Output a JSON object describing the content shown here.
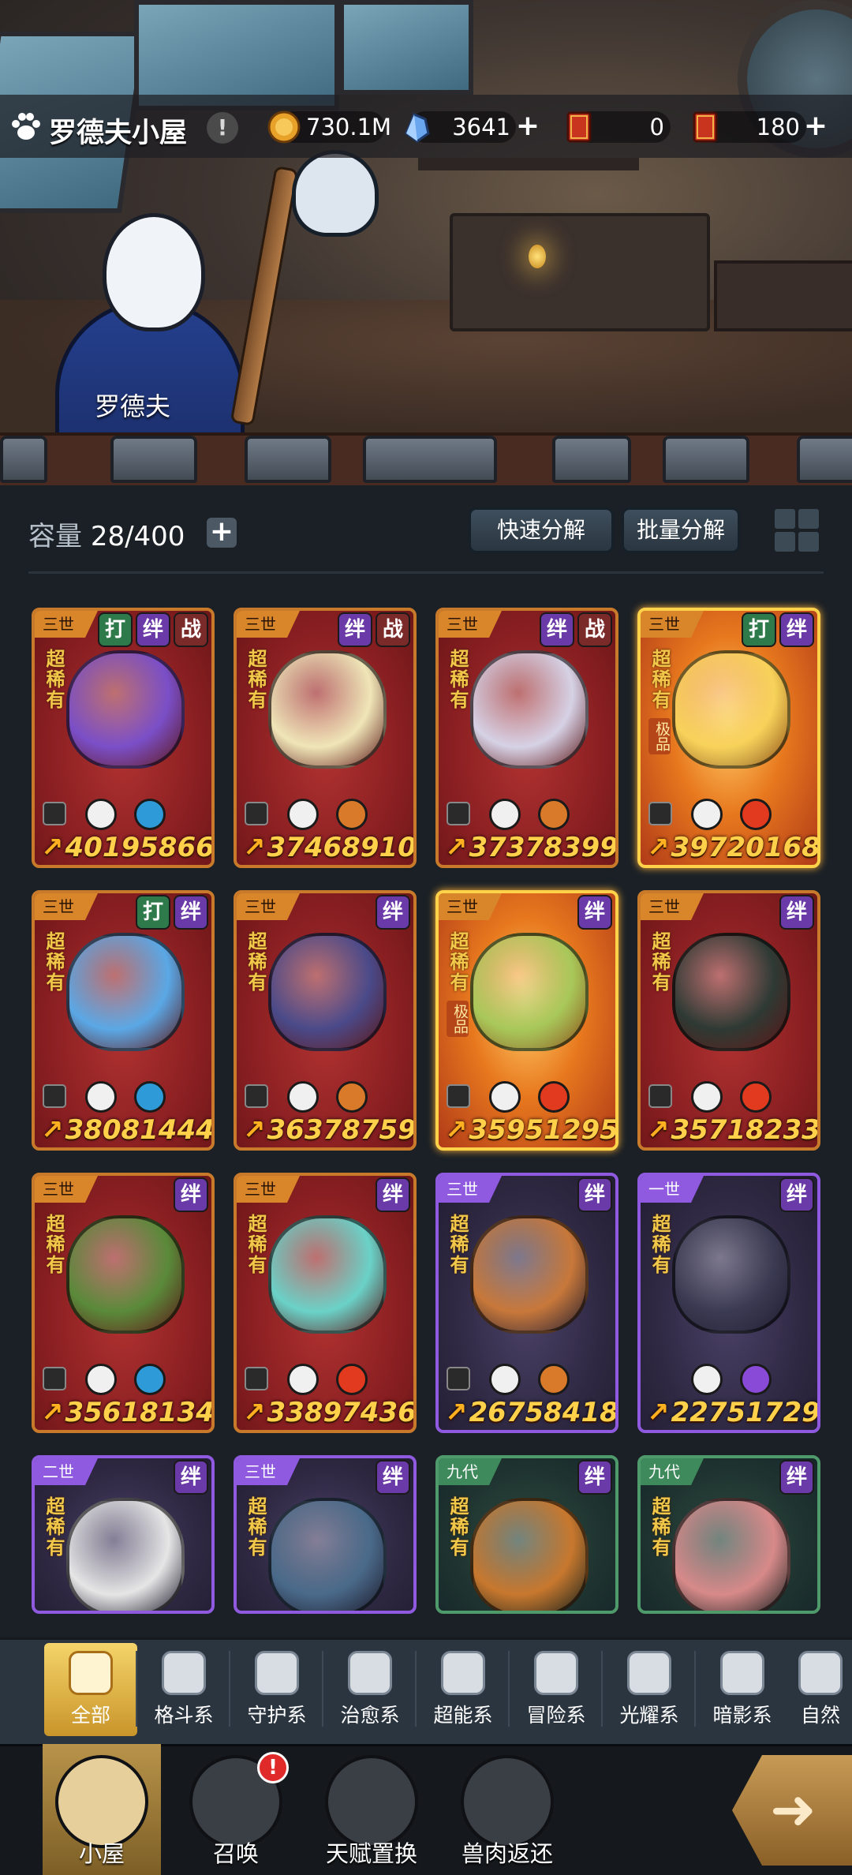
{
  "header": {
    "title": "罗德夫小屋",
    "npc_name": "罗德夫",
    "resources": [
      {
        "icon": "gold-coin-icon",
        "value": "730.1M",
        "has_plus": false
      },
      {
        "icon": "blue-crystal-icon",
        "value": "3641",
        "has_plus": true
      },
      {
        "icon": "red-ticket-icon",
        "value": "0",
        "has_plus": false,
        "ticket_char": "代"
      },
      {
        "icon": "red-ticket-icon",
        "value": "180",
        "has_plus": true,
        "ticket_char": "吉"
      }
    ]
  },
  "toolbar": {
    "capacity_label": "容量",
    "capacity_value": "28/400",
    "quick_decompose": "快速分解",
    "batch_decompose": "批量分解"
  },
  "cards": [
    {
      "gen": "三世",
      "tags": [
        "打",
        "绊",
        "战"
      ],
      "rarity": "超稀有",
      "excellent": "",
      "style": "red",
      "locked": true,
      "attrs": [
        "crystal",
        "water"
      ],
      "power": "40195866",
      "beast_color": "#7a4fc8"
    },
    {
      "gen": "三世",
      "tags": [
        "绊",
        "战"
      ],
      "rarity": "超稀有",
      "excellent": "",
      "style": "red",
      "locked": true,
      "attrs": [
        "fist",
        "earth"
      ],
      "power": "37468910",
      "beast_color": "#efe6b8"
    },
    {
      "gen": "三世",
      "tags": [
        "绊",
        "战"
      ],
      "rarity": "超稀有",
      "excellent": "",
      "style": "red",
      "locked": true,
      "attrs": [
        "psychic",
        "earth"
      ],
      "power": "37378399",
      "beast_color": "#d6d2e6"
    },
    {
      "gen": "三世",
      "tags": [
        "打",
        "绊"
      ],
      "rarity": "超稀有",
      "excellent": "极品",
      "style": "gold",
      "locked": true,
      "attrs": [
        "fist",
        "fire"
      ],
      "power": "39720168",
      "beast_color": "#f7d25a"
    },
    {
      "gen": "三世",
      "tags": [
        "打",
        "绊"
      ],
      "rarity": "超稀有",
      "excellent": "",
      "style": "red",
      "locked": true,
      "attrs": [
        "fist",
        "water"
      ],
      "power": "38081444",
      "beast_color": "#5aa8e6"
    },
    {
      "gen": "三世",
      "tags": [
        "绊"
      ],
      "rarity": "超稀有",
      "excellent": "",
      "style": "red",
      "locked": true,
      "attrs": [
        "shield",
        "earth"
      ],
      "power": "36378759",
      "beast_color": "#4a4a8a"
    },
    {
      "gen": "三世",
      "tags": [
        "绊"
      ],
      "rarity": "超稀有",
      "excellent": "极品",
      "style": "gold",
      "locked": true,
      "attrs": [
        "psychic",
        "fire"
      ],
      "power": "35951295",
      "beast_color": "#a8c85a"
    },
    {
      "gen": "三世",
      "tags": [
        "绊"
      ],
      "rarity": "超稀有",
      "excellent": "",
      "style": "red",
      "locked": true,
      "attrs": [
        "shield",
        "fire"
      ],
      "power": "35718233",
      "beast_color": "#2e3a34"
    },
    {
      "gen": "三世",
      "tags": [
        "绊"
      ],
      "rarity": "超稀有",
      "excellent": "",
      "style": "red",
      "locked": true,
      "attrs": [
        "shield",
        "water"
      ],
      "power": "35618134",
      "beast_color": "#5a8a3a"
    },
    {
      "gen": "三世",
      "tags": [
        "绊"
      ],
      "rarity": "超稀有",
      "excellent": "",
      "style": "red",
      "locked": true,
      "attrs": [
        "leaf",
        "fire"
      ],
      "power": "33897436",
      "beast_color": "#6ad2c8"
    },
    {
      "gen": "三世",
      "tags": [
        "绊"
      ],
      "rarity": "超稀有",
      "excellent": "",
      "style": "purple",
      "locked": true,
      "attrs": [
        "psychic",
        "earth"
      ],
      "power": "26758418",
      "beast_color": "#c8783a"
    },
    {
      "gen": "一世",
      "tags": [
        "绊"
      ],
      "rarity": "超稀有",
      "excellent": "",
      "style": "purple",
      "locked": false,
      "attrs": [
        "shadow",
        "moon"
      ],
      "power": "22751729",
      "beast_color": "#3a3a52"
    },
    {
      "gen": "二世",
      "tags": [
        "绊"
      ],
      "rarity": "超稀有",
      "excellent": "",
      "style": "purple",
      "locked": false,
      "attrs": [],
      "power": "",
      "beast_color": "#e6e6e6"
    },
    {
      "gen": "三世",
      "tags": [
        "绊"
      ],
      "rarity": "超稀有",
      "excellent": "",
      "style": "purple",
      "locked": false,
      "attrs": [],
      "power": "",
      "beast_color": "#4a6a8a"
    },
    {
      "gen": "九代",
      "tags": [
        "绊"
      ],
      "rarity": "超稀有",
      "excellent": "",
      "style": "green",
      "locked": false,
      "attrs": [],
      "power": "",
      "beast_color": "#c8782e"
    },
    {
      "gen": "九代",
      "tags": [
        "绊"
      ],
      "rarity": "超稀有",
      "excellent": "",
      "style": "green",
      "locked": false,
      "attrs": [],
      "power": "",
      "beast_color": "#d88a8a"
    }
  ],
  "categories": [
    {
      "label": "全部",
      "icon": "all-blocks-icon",
      "active": true
    },
    {
      "label": "格斗系",
      "icon": "fist-icon",
      "active": false
    },
    {
      "label": "守护系",
      "icon": "shield-icon",
      "active": false
    },
    {
      "label": "治愈系",
      "icon": "sprout-icon",
      "active": false
    },
    {
      "label": "超能系",
      "icon": "alien-icon",
      "active": false
    },
    {
      "label": "冒险系",
      "icon": "lantern-icon",
      "active": false
    },
    {
      "label": "光耀系",
      "icon": "star-icon",
      "active": false
    },
    {
      "label": "暗影系",
      "icon": "eye-icon",
      "active": false
    },
    {
      "label": "自然",
      "icon": "leaf-icon",
      "active": false
    }
  ],
  "nav": [
    {
      "label": "小屋",
      "icon": "house-icon",
      "active": true
    },
    {
      "label": "召唤",
      "icon": "egg-icon",
      "active": false,
      "badge": "!"
    },
    {
      "label": "天赋置换",
      "icon": "swap-arrows-icon",
      "active": false
    },
    {
      "label": "兽肉返还",
      "icon": "meat-icon",
      "active": false
    }
  ],
  "colors": {
    "accent_gold": "#f2c84a",
    "power_text": "#ffd04a",
    "badge_red": "#e02a2a"
  }
}
